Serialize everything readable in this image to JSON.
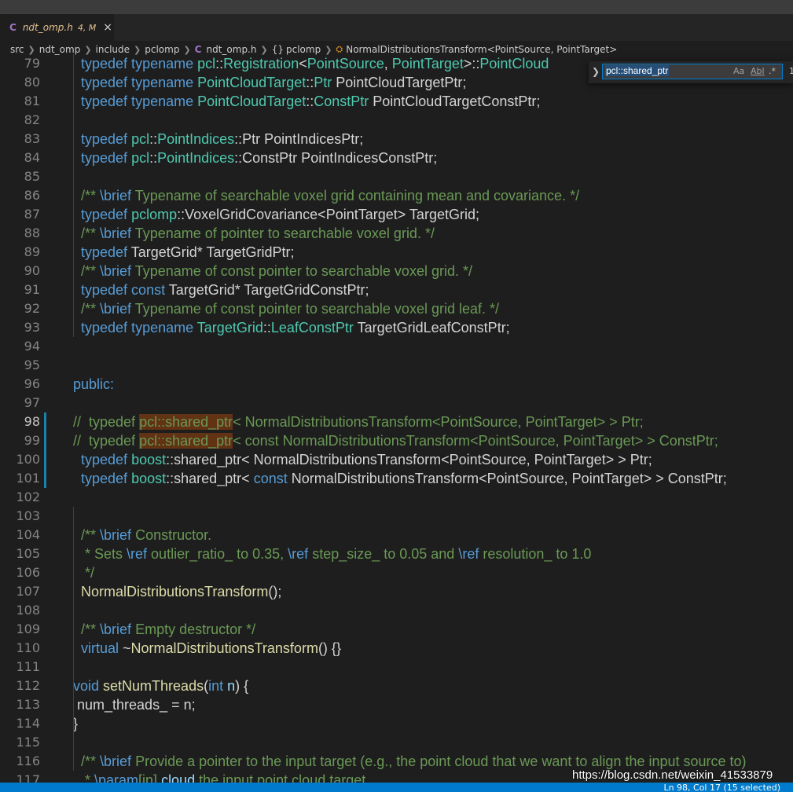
{
  "tab": {
    "icon": "C",
    "filename": "ndt_omp.h",
    "status": "4, M",
    "close": "×"
  },
  "breadcrumb": {
    "src": "src",
    "ndt_omp": "ndt_omp",
    "include": "include",
    "pclomp": "pclomp",
    "file_icon": "C",
    "file": "ndt_omp.h",
    "namespace_icon": "{}",
    "namespace": "pclomp",
    "class_icon": "symbol-class-icon",
    "class": "NormalDistributionsTransform<PointSource, PointTarget>"
  },
  "find": {
    "query": "pcl::shared_ptr",
    "match_case": "Aa",
    "whole_word": "Abl",
    "regex": ".*",
    "count": "1"
  },
  "editor": {
    "line_numbers": [
      "79",
      "80",
      "81",
      "82",
      "83",
      "84",
      "85",
      "86",
      "87",
      "88",
      "89",
      "90",
      "91",
      "92",
      "93",
      "94",
      "95",
      "96",
      "97",
      "98",
      "99",
      "100",
      "101",
      "102",
      "103",
      "104",
      "105",
      "106",
      "107",
      "108",
      "109",
      "110",
      "111",
      "112",
      "113",
      "114",
      "115",
      "116",
      "117"
    ],
    "current_line": "98",
    "lines": [
      [
        {
          "t": "  ",
          "c": "d"
        },
        {
          "t": "typedef typename ",
          "c": "k"
        },
        {
          "t": "pcl",
          "c": "t"
        },
        {
          "t": "::",
          "c": "d"
        },
        {
          "t": "Registration",
          "c": "t"
        },
        {
          "t": "<",
          "c": "d"
        },
        {
          "t": "PointSource",
          "c": "t"
        },
        {
          "t": ", ",
          "c": "d"
        },
        {
          "t": "PointTarget",
          "c": "t"
        },
        {
          "t": ">::",
          "c": "d"
        },
        {
          "t": "PointCloud ",
          "c": "t"
        }
      ],
      [
        {
          "t": "  ",
          "c": "d"
        },
        {
          "t": "typedef typename ",
          "c": "k"
        },
        {
          "t": "PointCloudTarget",
          "c": "t"
        },
        {
          "t": "::",
          "c": "d"
        },
        {
          "t": "Ptr",
          "c": "t"
        },
        {
          "t": " PointCloudTargetPtr;",
          "c": "d"
        }
      ],
      [
        {
          "t": "  ",
          "c": "d"
        },
        {
          "t": "typedef typename ",
          "c": "k"
        },
        {
          "t": "PointCloudTarget",
          "c": "t"
        },
        {
          "t": "::",
          "c": "d"
        },
        {
          "t": "ConstPtr",
          "c": "t"
        },
        {
          "t": " PointCloudTargetConstPtr;",
          "c": "d"
        }
      ],
      [],
      [
        {
          "t": "  ",
          "c": "d"
        },
        {
          "t": "typedef ",
          "c": "k"
        },
        {
          "t": "pcl",
          "c": "t"
        },
        {
          "t": "::",
          "c": "d"
        },
        {
          "t": "PointIndices",
          "c": "t"
        },
        {
          "t": "::Ptr PointIndicesPtr;",
          "c": "d"
        }
      ],
      [
        {
          "t": "  ",
          "c": "d"
        },
        {
          "t": "typedef ",
          "c": "k"
        },
        {
          "t": "pcl",
          "c": "t"
        },
        {
          "t": "::",
          "c": "d"
        },
        {
          "t": "PointIndices",
          "c": "t"
        },
        {
          "t": "::ConstPtr PointIndicesConstPtr;",
          "c": "d"
        }
      ],
      [],
      [
        {
          "t": "  ",
          "c": "d"
        },
        {
          "t": "/** ",
          "c": "c"
        },
        {
          "t": "\\brief",
          "c": "k"
        },
        {
          "t": " Typename of searchable voxel grid containing mean and covariance. */",
          "c": "c"
        }
      ],
      [
        {
          "t": "  ",
          "c": "d"
        },
        {
          "t": "typedef ",
          "c": "k"
        },
        {
          "t": "pclomp",
          "c": "t"
        },
        {
          "t": "::VoxelGridCovariance<PointTarget> TargetGrid;",
          "c": "d"
        }
      ],
      [
        {
          "t": "  ",
          "c": "d"
        },
        {
          "t": "/** ",
          "c": "c"
        },
        {
          "t": "\\brief",
          "c": "k"
        },
        {
          "t": " Typename of pointer to searchable voxel grid. */",
          "c": "c"
        }
      ],
      [
        {
          "t": "  ",
          "c": "d"
        },
        {
          "t": "typedef ",
          "c": "k"
        },
        {
          "t": "TargetGrid* TargetGridPtr;",
          "c": "d"
        }
      ],
      [
        {
          "t": "  ",
          "c": "d"
        },
        {
          "t": "/** ",
          "c": "c"
        },
        {
          "t": "\\brief",
          "c": "k"
        },
        {
          "t": " Typename of const pointer to searchable voxel grid. */",
          "c": "c"
        }
      ],
      [
        {
          "t": "  ",
          "c": "d"
        },
        {
          "t": "typedef const ",
          "c": "k"
        },
        {
          "t": "TargetGrid* TargetGridConstPtr;",
          "c": "d"
        }
      ],
      [
        {
          "t": "  ",
          "c": "d"
        },
        {
          "t": "/** ",
          "c": "c"
        },
        {
          "t": "\\brief",
          "c": "k"
        },
        {
          "t": " Typename of const pointer to searchable voxel grid leaf. */",
          "c": "c"
        }
      ],
      [
        {
          "t": "  ",
          "c": "d"
        },
        {
          "t": "typedef typename ",
          "c": "k"
        },
        {
          "t": "TargetGrid",
          "c": "t"
        },
        {
          "t": "::",
          "c": "d"
        },
        {
          "t": "LeafConstPtr",
          "c": "t"
        },
        {
          "t": " TargetGridLeafConstPtr;",
          "c": "d"
        }
      ],
      [],
      [],
      [
        {
          "t": "public:",
          "c": "k"
        }
      ],
      [],
      [
        {
          "t": "//  typedef ",
          "c": "c"
        },
        {
          "t": "pcl::shared_ptr",
          "c": "c",
          "hl": true
        },
        {
          "t": "< NormalDistributionsTransform<PointSource, PointTarget> > Ptr;",
          "c": "c"
        }
      ],
      [
        {
          "t": "//  typedef ",
          "c": "c"
        },
        {
          "t": "pcl::shared_ptr",
          "c": "c",
          "hl": true
        },
        {
          "t": "< const NormalDistributionsTransform<PointSource, PointTarget> > ConstPtr;",
          "c": "c"
        }
      ],
      [
        {
          "t": "  ",
          "c": "d"
        },
        {
          "t": "typedef ",
          "c": "k"
        },
        {
          "t": "boost",
          "c": "t"
        },
        {
          "t": "::shared_ptr< NormalDistributionsTransform<PointSource, PointTarget> > Ptr;",
          "c": "d"
        }
      ],
      [
        {
          "t": "  ",
          "c": "d"
        },
        {
          "t": "typedef ",
          "c": "k"
        },
        {
          "t": "boost",
          "c": "t"
        },
        {
          "t": "::shared_ptr< ",
          "c": "d"
        },
        {
          "t": "const ",
          "c": "k"
        },
        {
          "t": "NormalDistributionsTransform<PointSource, PointTarget> > ConstPtr;",
          "c": "d"
        }
      ],
      [],
      [],
      [
        {
          "t": "  ",
          "c": "d"
        },
        {
          "t": "/** ",
          "c": "c"
        },
        {
          "t": "\\brief",
          "c": "k"
        },
        {
          "t": " Constructor.",
          "c": "c"
        }
      ],
      [
        {
          "t": "   * Sets ",
          "c": "c"
        },
        {
          "t": "\\ref",
          "c": "k"
        },
        {
          "t": " outlier_ratio_ to 0.35, ",
          "c": "c"
        },
        {
          "t": "\\ref",
          "c": "k"
        },
        {
          "t": " step_size_ to 0.05 and ",
          "c": "c"
        },
        {
          "t": "\\ref",
          "c": "k"
        },
        {
          "t": " resolution_ to 1.0",
          "c": "c"
        }
      ],
      [
        {
          "t": "   */",
          "c": "c"
        }
      ],
      [
        {
          "t": "  ",
          "c": "d"
        },
        {
          "t": "NormalDistributionsTransform",
          "c": "f"
        },
        {
          "t": "();",
          "c": "d"
        }
      ],
      [],
      [
        {
          "t": "  ",
          "c": "d"
        },
        {
          "t": "/** ",
          "c": "c"
        },
        {
          "t": "\\brief",
          "c": "k"
        },
        {
          "t": " Empty destructor */",
          "c": "c"
        }
      ],
      [
        {
          "t": "  ",
          "c": "d"
        },
        {
          "t": "virtual ",
          "c": "k"
        },
        {
          "t": "~",
          "c": "d"
        },
        {
          "t": "NormalDistributionsTransform",
          "c": "f"
        },
        {
          "t": "() {}",
          "c": "d"
        }
      ],
      [],
      [
        {
          "t": "void ",
          "c": "k"
        },
        {
          "t": "setNumThreads",
          "c": "f"
        },
        {
          "t": "(",
          "c": "d"
        },
        {
          "t": "int ",
          "c": "k"
        },
        {
          "t": "n",
          "c": "v"
        },
        {
          "t": ") {",
          "c": "d"
        }
      ],
      [
        {
          "t": " num_threads_ = n;",
          "c": "d"
        }
      ],
      [
        {
          "t": "}",
          "c": "d"
        }
      ],
      [],
      [
        {
          "t": "  ",
          "c": "d"
        },
        {
          "t": "/** ",
          "c": "c"
        },
        {
          "t": "\\brief",
          "c": "k"
        },
        {
          "t": " Provide a pointer to the input target (e.g., the point cloud that we want to align the input source to)",
          "c": "c"
        }
      ],
      [
        {
          "t": "   * ",
          "c": "c"
        },
        {
          "t": "\\param",
          "c": "k"
        },
        {
          "t": "[in] ",
          "c": "c"
        },
        {
          "t": "cloud",
          "c": "v"
        },
        {
          "t": " the input point cloud target",
          "c": "c"
        }
      ]
    ]
  },
  "status": {
    "position": "Ln 98, Col 17 (15 selected)"
  },
  "watermark": "https://blog.csdn.net/weixin_41533879"
}
